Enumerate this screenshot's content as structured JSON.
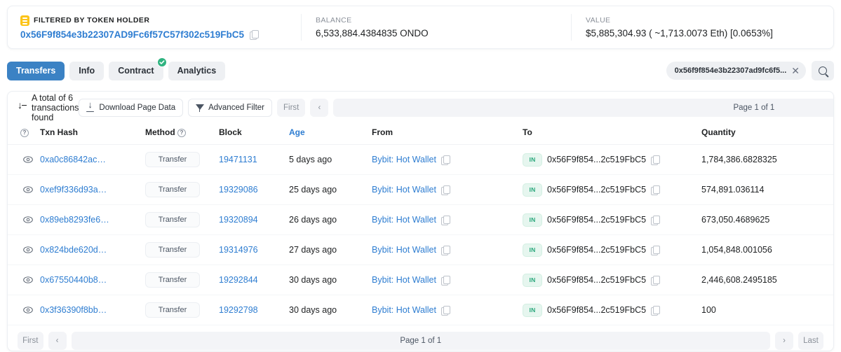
{
  "summary": {
    "filtered_label": "FILTERED BY TOKEN HOLDER",
    "filtered_address": "0x56F9f854e3b22307AD9Fc6f57C57f302c519FbC5",
    "balance_label": "BALANCE",
    "balance_value": "6,533,884.4384835 ONDO",
    "value_label": "VALUE",
    "value_value": "$5,885,304.93 ( ~1,713.0073 Eth) [0.0653%]"
  },
  "tabs": [
    {
      "label": "Transfers",
      "active": true,
      "badge": false
    },
    {
      "label": "Info",
      "active": false,
      "badge": false
    },
    {
      "label": "Contract",
      "active": false,
      "badge": true
    },
    {
      "label": "Analytics",
      "active": false,
      "badge": false
    }
  ],
  "search": {
    "chip_value": "0x56f9f854e3b22307ad9fc6f5...",
    "clear_label": "✕"
  },
  "toolbar": {
    "total_text": "A total of 6 transactions found",
    "download_label": "Download Page Data",
    "advanced_filter_label": "Advanced Filter"
  },
  "pagination": {
    "first": "First",
    "prev": "‹",
    "page": "Page 1 of 1",
    "next": "›",
    "last": "Last"
  },
  "table": {
    "headers": {
      "eye": "",
      "txn_hash": "Txn Hash",
      "method": "Method",
      "block": "Block",
      "age": "Age",
      "from": "From",
      "to": "To",
      "quantity": "Quantity"
    },
    "rows": [
      {
        "hash": "0xa0c86842ac…",
        "method": "Transfer",
        "block": "19471131",
        "age": "5 days ago",
        "from": "Bybit: Hot Wallet",
        "direction": "IN",
        "to": "0x56F9f854...2c519FbC5",
        "quantity": "1,784,386.6828325"
      },
      {
        "hash": "0xef9f336d93a…",
        "method": "Transfer",
        "block": "19329086",
        "age": "25 days ago",
        "from": "Bybit: Hot Wallet",
        "direction": "IN",
        "to": "0x56F9f854...2c519FbC5",
        "quantity": "574,891.036114"
      },
      {
        "hash": "0x89eb8293fe6…",
        "method": "Transfer",
        "block": "19320894",
        "age": "26 days ago",
        "from": "Bybit: Hot Wallet",
        "direction": "IN",
        "to": "0x56F9f854...2c519FbC5",
        "quantity": "673,050.4689625"
      },
      {
        "hash": "0x824bde620d…",
        "method": "Transfer",
        "block": "19314976",
        "age": "27 days ago",
        "from": "Bybit: Hot Wallet",
        "direction": "IN",
        "to": "0x56F9f854...2c519FbC5",
        "quantity": "1,054,848.001056"
      },
      {
        "hash": "0x67550440b8…",
        "method": "Transfer",
        "block": "19292844",
        "age": "30 days ago",
        "from": "Bybit: Hot Wallet",
        "direction": "IN",
        "to": "0x56F9f854...2c519FbC5",
        "quantity": "2,446,608.2495185"
      },
      {
        "hash": "0x3f36390f8bb…",
        "method": "Transfer",
        "block": "19292798",
        "age": "30 days ago",
        "from": "Bybit: Hot Wallet",
        "direction": "IN",
        "to": "0x56F9f854...2c519FbC5",
        "quantity": "100"
      }
    ]
  },
  "colors": {
    "link": "#2e7dd1",
    "tab_active_bg": "#3b82c4",
    "badge_green": "#27a67a",
    "filter_yellow": "#fcc419"
  }
}
